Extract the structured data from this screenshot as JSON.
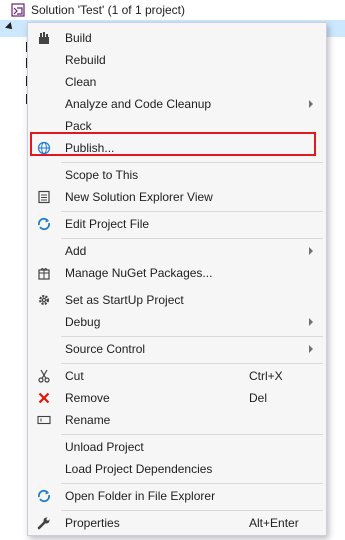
{
  "tree": {
    "solution_label": "Solution 'Test' (1 of 1 project)"
  },
  "menu": {
    "items": [
      {
        "label": "Build",
        "shortcut": "",
        "icon": "build-icon",
        "submenu": false
      },
      {
        "label": "Rebuild",
        "shortcut": "",
        "icon": "",
        "submenu": false
      },
      {
        "label": "Clean",
        "shortcut": "",
        "icon": "",
        "submenu": false
      },
      {
        "label": "Analyze and Code Cleanup",
        "shortcut": "",
        "icon": "",
        "submenu": true
      },
      {
        "label": "Pack",
        "shortcut": "",
        "icon": "",
        "submenu": false
      },
      {
        "label": "Publish...",
        "shortcut": "",
        "icon": "globe-icon",
        "submenu": false
      },
      {
        "label": "Scope to This",
        "shortcut": "",
        "icon": "",
        "submenu": false
      },
      {
        "label": "New Solution Explorer View",
        "shortcut": "",
        "icon": "new-view-icon",
        "submenu": false
      },
      {
        "label": "Edit Project File",
        "shortcut": "",
        "icon": "edit-refresh-icon",
        "submenu": false
      },
      {
        "label": "Add",
        "shortcut": "",
        "icon": "",
        "submenu": true
      },
      {
        "label": "Manage NuGet Packages...",
        "shortcut": "",
        "icon": "nuget-icon",
        "submenu": false
      },
      {
        "label": "Set as StartUp Project",
        "shortcut": "",
        "icon": "gear-icon",
        "submenu": false
      },
      {
        "label": "Debug",
        "shortcut": "",
        "icon": "",
        "submenu": true
      },
      {
        "label": "Source Control",
        "shortcut": "",
        "icon": "",
        "submenu": true
      },
      {
        "label": "Cut",
        "shortcut": "Ctrl+X",
        "icon": "scissors-icon",
        "submenu": false
      },
      {
        "label": "Remove",
        "shortcut": "Del",
        "icon": "remove-x-icon",
        "submenu": false
      },
      {
        "label": "Rename",
        "shortcut": "",
        "icon": "rename-icon",
        "submenu": false
      },
      {
        "label": "Unload Project",
        "shortcut": "",
        "icon": "",
        "submenu": false
      },
      {
        "label": "Load Project Dependencies",
        "shortcut": "",
        "icon": "",
        "submenu": false
      },
      {
        "label": "Open Folder in File Explorer",
        "shortcut": "",
        "icon": "open-folder-icon",
        "submenu": false
      },
      {
        "label": "Properties",
        "shortcut": "Alt+Enter",
        "icon": "wrench-icon",
        "submenu": false
      }
    ]
  },
  "colors": {
    "highlight_border": "#e0191e",
    "selection_bg": "#cce8ff",
    "remove_red": "#e51400",
    "globe_blue": "#1e7ecf"
  }
}
